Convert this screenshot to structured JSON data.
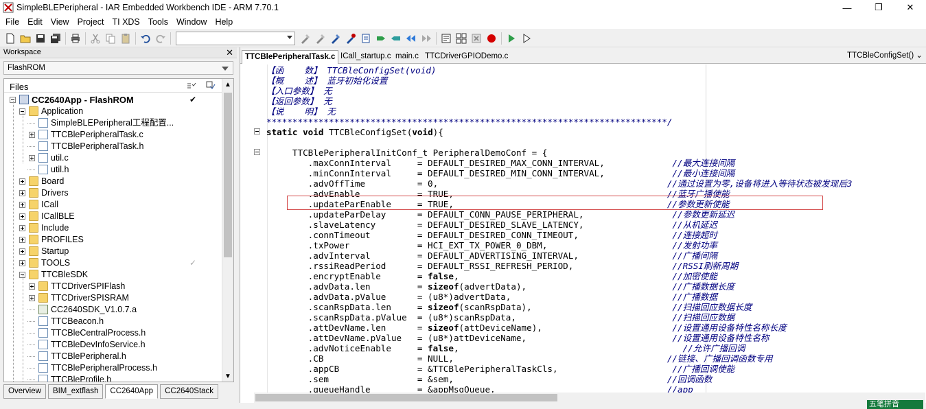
{
  "window": {
    "title": "SimpleBLEPeripheral - IAR Embedded Workbench IDE - ARM 7.70.1"
  },
  "menu": [
    "File",
    "Edit",
    "View",
    "Project",
    "TI XDS",
    "Tools",
    "Window",
    "Help"
  ],
  "toolbar": {
    "icons": [
      "new-file-icon",
      "open-icon",
      "save-icon",
      "save-all-icon",
      "print-icon",
      "cut-icon",
      "copy-icon",
      "paste-icon",
      "undo-icon",
      "redo-icon",
      "find-icon",
      "find-next-icon",
      "find-prev-icon",
      "go-to-icon",
      "bookmark-icon",
      "bookmark-next-icon",
      "bookmark-prev-icon",
      "nav-back-icon",
      "nav-forward-icon",
      "compile-icon",
      "make-icon",
      "stop-build-icon",
      "breakpoint-icon",
      "download-debug-icon",
      "debug-no-download-icon"
    ],
    "search_value": ""
  },
  "workspace": {
    "header": "Workspace",
    "config": "FlashROM",
    "files_label": "Files",
    "tree": [
      {
        "label": "CC2640App - FlashROM",
        "level": 0,
        "type": "root",
        "expand": "minus",
        "check": "✔"
      },
      {
        "label": "Application",
        "level": 1,
        "type": "folder",
        "expand": "minus"
      },
      {
        "label": "SimpleBLEPeripheral工程配置...",
        "level": 2,
        "type": "file",
        "expand": ""
      },
      {
        "label": "TTCBlePeripheralTask.c",
        "level": 2,
        "type": "cfile",
        "expand": "plus"
      },
      {
        "label": "TTCBlePeripheralTask.h",
        "level": 2,
        "type": "hfile",
        "expand": ""
      },
      {
        "label": "util.c",
        "level": 2,
        "type": "cfile",
        "expand": "plus"
      },
      {
        "label": "util.h",
        "level": 2,
        "type": "hfile",
        "expand": ""
      },
      {
        "label": "Board",
        "level": 1,
        "type": "folder",
        "expand": "plus"
      },
      {
        "label": "Drivers",
        "level": 1,
        "type": "folder",
        "expand": "plus"
      },
      {
        "label": "ICall",
        "level": 1,
        "type": "folder",
        "expand": "plus"
      },
      {
        "label": "ICallBLE",
        "level": 1,
        "type": "folder",
        "expand": "plus"
      },
      {
        "label": "Include",
        "level": 1,
        "type": "folder",
        "expand": "plus"
      },
      {
        "label": "PROFILES",
        "level": 1,
        "type": "folder",
        "expand": "plus"
      },
      {
        "label": "Startup",
        "level": 1,
        "type": "folder",
        "expand": "plus"
      },
      {
        "label": "TOOLS",
        "level": 1,
        "type": "folder",
        "expand": "plus",
        "check": "✓"
      },
      {
        "label": "TTCBleSDK",
        "level": 1,
        "type": "folder",
        "expand": "minus"
      },
      {
        "label": "TTCDriverSPIFlash",
        "level": 2,
        "type": "folder",
        "expand": "plus"
      },
      {
        "label": "TTCDriverSPISRAM",
        "level": 2,
        "type": "folder",
        "expand": "plus"
      },
      {
        "label": "CC2640SDK_V1.0.7.a",
        "level": 2,
        "type": "lib",
        "expand": ""
      },
      {
        "label": "TTCBeacon.h",
        "level": 2,
        "type": "hfile",
        "expand": ""
      },
      {
        "label": "TTCBleCentralProcess.h",
        "level": 2,
        "type": "hfile",
        "expand": ""
      },
      {
        "label": "TTCBleDevInfoService.h",
        "level": 2,
        "type": "hfile",
        "expand": ""
      },
      {
        "label": "TTCBlePeripheral.h",
        "level": 2,
        "type": "hfile",
        "expand": ""
      },
      {
        "label": "TTCBlePeripheralProcess.h",
        "level": 2,
        "type": "hfile",
        "expand": ""
      },
      {
        "label": "TTCBleProfile.h",
        "level": 2,
        "type": "hfile",
        "expand": ""
      }
    ],
    "tabs": [
      "Overview",
      "BIM_extflash",
      "CC2640App",
      "CC2640Stack"
    ],
    "active_tab": "CC2640App"
  },
  "editor": {
    "tabs": [
      "TTCBlePeripheralTask.c",
      "ICall_startup.c",
      "main.c",
      "TTCDriverGPIODemo.c"
    ],
    "active_tab": "TTCBlePeripheralTask.c",
    "function": "TTCBleConfigSet() ⌄",
    "lines": [
      [
        {
          "t": "【函    数】 TTCBleConfigSet(void)",
          "c": "cmt"
        }
      ],
      [
        {
          "t": "【概    述】 蓝牙初始化设置",
          "c": "cmt"
        }
      ],
      [
        {
          "t": "【入口参数】 无",
          "c": "cmt"
        }
      ],
      [
        {
          "t": "【返回参数】 无",
          "c": "cmt"
        }
      ],
      [
        {
          "t": "【说    明】 无",
          "c": "cmt"
        }
      ],
      [
        {
          "t": "*****************************************************************************/",
          "c": "cmt"
        }
      ],
      [
        {
          "t": "static void ",
          "c": "kw"
        },
        {
          "t": "TTCBleConfigSet(",
          "c": ""
        },
        {
          "t": "void",
          "c": "kw"
        },
        {
          "t": "){",
          "c": ""
        }
      ],
      [
        {
          "t": "",
          "c": ""
        }
      ],
      [
        {
          "t": "     TTCBlePeripheralInitConf_t PeripheralDemoConf = {",
          "c": ""
        }
      ],
      [
        {
          "t": "        .maxConnInterval     = DEFAULT_DESIRED_MAX_CONN_INTERVAL,             ",
          "c": ""
        },
        {
          "t": "//最大连接间隔",
          "c": "cmt"
        }
      ],
      [
        {
          "t": "        .minConnInterval     = DEFAULT_DESIRED_MIN_CONN_INTERVAL,             ",
          "c": ""
        },
        {
          "t": "//最小连接间隔",
          "c": "cmt"
        }
      ],
      [
        {
          "t": "        .advOffTime          = ",
          "c": ""
        },
        {
          "t": "0",
          "c": "num"
        },
        {
          "t": ",                                            ",
          "c": ""
        },
        {
          "t": "//通过设置为零,设备将进入等待状态被发现后3",
          "c": "cmt"
        }
      ],
      [
        {
          "t": "        .advEnable           = TRUE,                                         ",
          "c": ""
        },
        {
          "t": "//蓝牙广播使能",
          "c": "cmt"
        }
      ],
      [
        {
          "t": "        .updateParEnable     = TRUE,                                         ",
          "c": ""
        },
        {
          "t": "//参数更新使能",
          "c": "cmt"
        }
      ],
      [
        {
          "t": "        .updateParDelay      = DEFAULT_CONN_PAUSE_PERIPHERAL,                 ",
          "c": ""
        },
        {
          "t": "//参数更新延迟",
          "c": "cmt"
        }
      ],
      [
        {
          "t": "        .slaveLatency        = DEFAULT_DESIRED_SLAVE_LATENCY,                 ",
          "c": ""
        },
        {
          "t": "//从机延迟",
          "c": "cmt"
        }
      ],
      [
        {
          "t": "        .connTimeout         = DEFAULT_DESIRED_CONN_TIMEOUT,                  ",
          "c": ""
        },
        {
          "t": "//连接超时",
          "c": "cmt"
        }
      ],
      [
        {
          "t": "        .txPower             = HCI_EXT_TX_POWER_0_DBM,                        ",
          "c": ""
        },
        {
          "t": "//发射功率",
          "c": "cmt"
        }
      ],
      [
        {
          "t": "        .advInterval         = DEFAULT_ADVERTISING_INTERVAL,                  ",
          "c": ""
        },
        {
          "t": "//广播间隔",
          "c": "cmt"
        }
      ],
      [
        {
          "t": "        .rssiReadPeriod      = DEFAULT_RSSI_REFRESH_PERIOD,                   ",
          "c": ""
        },
        {
          "t": "//RSSI刷新周期",
          "c": "cmt"
        }
      ],
      [
        {
          "t": "        .encryptEnable       = ",
          "c": ""
        },
        {
          "t": "false",
          "c": "kw"
        },
        {
          "t": ",                                         ",
          "c": ""
        },
        {
          "t": "//加密使能",
          "c": "cmt"
        }
      ],
      [
        {
          "t": "        .advData.len         = ",
          "c": ""
        },
        {
          "t": "sizeof",
          "c": "kw"
        },
        {
          "t": "(advertData),                            ",
          "c": ""
        },
        {
          "t": "//广播数据长度",
          "c": "cmt"
        }
      ],
      [
        {
          "t": "        .advData.pValue      = (u8*)advertData,                               ",
          "c": ""
        },
        {
          "t": "//广播数据",
          "c": "cmt"
        }
      ],
      [
        {
          "t": "        .scanRspData.len     = ",
          "c": ""
        },
        {
          "t": "sizeof",
          "c": "kw"
        },
        {
          "t": "(scanRspData),                           ",
          "c": ""
        },
        {
          "t": "//扫描回应数据长度",
          "c": "cmt"
        }
      ],
      [
        {
          "t": "        .scanRspData.pValue  = (u8*)scanRspData,                              ",
          "c": ""
        },
        {
          "t": "//扫描回应数据",
          "c": "cmt"
        }
      ],
      [
        {
          "t": "        .attDevName.len      = ",
          "c": ""
        },
        {
          "t": "sizeof",
          "c": "kw"
        },
        {
          "t": "(attDeviceName),                         ",
          "c": ""
        },
        {
          "t": "//设置通用设备特性名称长度",
          "c": "cmt"
        }
      ],
      [
        {
          "t": "        .attDevName.pValue   = (u8*)attDeviceName,                            ",
          "c": ""
        },
        {
          "t": "//设置通用设备特性名称",
          "c": "cmt"
        }
      ],
      [
        {
          "t": "        .advNoticeEnable     = ",
          "c": ""
        },
        {
          "t": "false",
          "c": "kw"
        },
        {
          "t": ",                                           ",
          "c": ""
        },
        {
          "t": "//允许广播回调",
          "c": "cmt"
        }
      ],
      [
        {
          "t": "        .CB                  = NULL,                                         ",
          "c": ""
        },
        {
          "t": "//链接、广播回调函数专用",
          "c": "cmt"
        }
      ],
      [
        {
          "t": "        .appCB               = &TTCBlePeripheralTaskCls,                      ",
          "c": ""
        },
        {
          "t": "//广播回调使能",
          "c": "cmt"
        }
      ],
      [
        {
          "t": "        .sem                 = &sem,                                         ",
          "c": ""
        },
        {
          "t": "//回调函数",
          "c": "cmt"
        }
      ],
      [
        {
          "t": "        .queueHandle         = &appMsgQueue,                                 ",
          "c": ""
        },
        {
          "t": "//app",
          "c": "cmt"
        }
      ]
    ]
  },
  "ime": {
    "label": "五笔拼音"
  },
  "colors": {
    "comment": "#000080",
    "highlight_box": "#d34848",
    "folder": "#f6d36a"
  }
}
